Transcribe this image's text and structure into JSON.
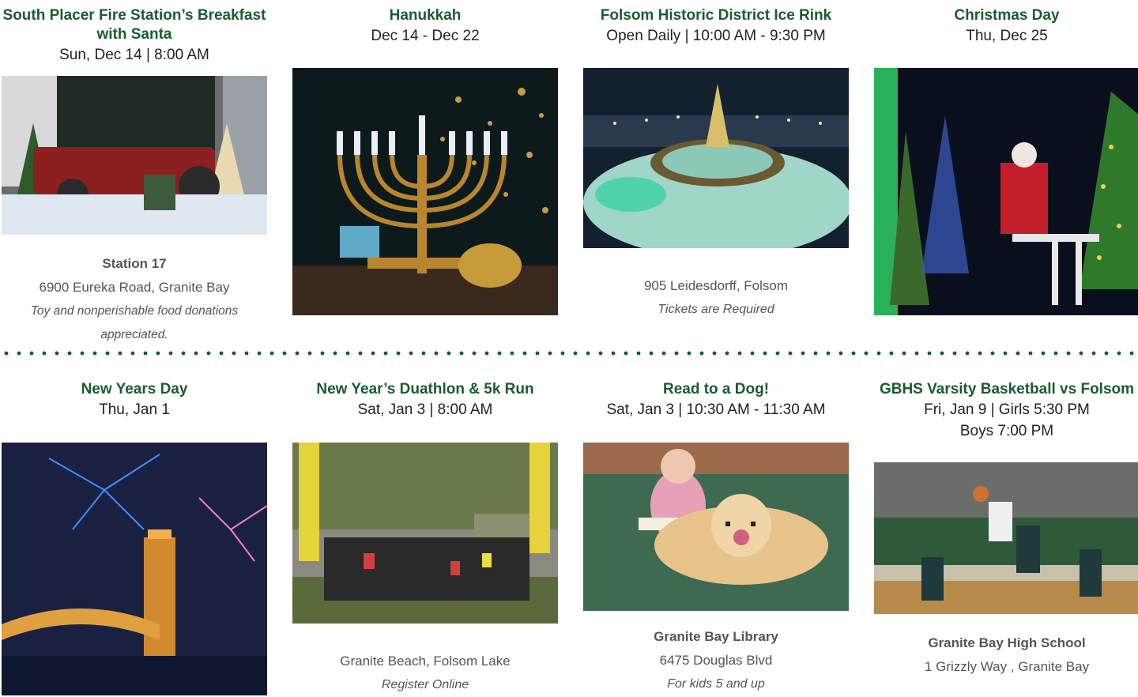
{
  "events_row1": [
    {
      "title": "South Placer Fire Station’s Breakfast with Santa",
      "when": "Sun, Dec 14 | 8:00 AM",
      "venue": "Station 17",
      "address": "6900 Eureka Road, Granite Bay",
      "note": "Toy and nonperishable food donations appreciated.",
      "image": "fire-truck-santa-photo"
    },
    {
      "title": "Hanukkah",
      "when": "Dec 14 - Dec 22",
      "image": "menorah-photo"
    },
    {
      "title": "Folsom Historic District Ice Rink",
      "when": "Open Daily | 10:00 AM - 9:30 PM",
      "address": "905 Leidesdorff, Folsom",
      "note": "Tickets are Required",
      "image": "ice-rink-photo"
    },
    {
      "title": "Christmas Day",
      "when": "Thu, Dec 25",
      "image": "santa-lights-photo"
    }
  ],
  "events_row2": [
    {
      "title": "New Years Day",
      "when": "Thu, Jan 1",
      "image": "fireworks-bridge-photo"
    },
    {
      "title": "New Year’s Duathlon & 5k Run",
      "when": "Sat, Jan 3 | 8:00 AM",
      "address": "Granite Beach, Folsom Lake",
      "note": "Register Online",
      "image": "race-start-photo"
    },
    {
      "title": "Read to a Dog!",
      "when": "Sat, Jan 3 | 10:30 AM - 11:30 AM",
      "venue": "Granite Bay Library",
      "address": "6475 Douglas Blvd",
      "note": "For kids 5 and up",
      "image": "reading-dog-photo"
    },
    {
      "title": "GBHS Varsity Basketball vs Folsom",
      "when": "Fri, Jan 9 | Girls 5:30 PM",
      "when2": "Boys 7:00 PM",
      "venue": "Granite Bay High School",
      "address": "1 Grizzly Way , Granite Bay",
      "image": "basketball-photo"
    }
  ],
  "colors": {
    "title": "#1a5c2e",
    "text": "#222222",
    "muted": "#555555",
    "divider": "#1a5c2e"
  }
}
